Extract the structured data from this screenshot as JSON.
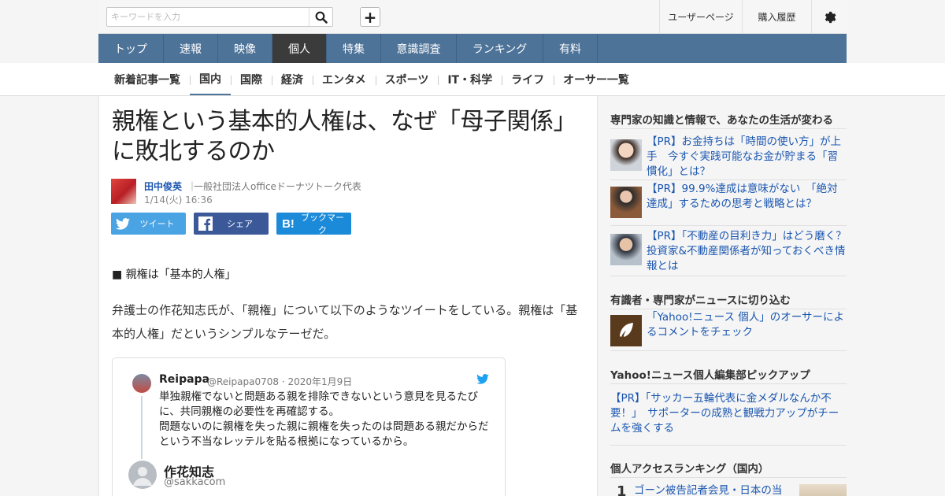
{
  "search": {
    "placeholder": "キーワードを入力"
  },
  "topbar": {
    "user_page": "ユーザーページ",
    "history": "購入履歴"
  },
  "nav": {
    "items": [
      "トップ",
      "速報",
      "映像",
      "個人",
      "特集",
      "意識調査",
      "ランキング",
      "有料"
    ],
    "active": "個人"
  },
  "subnav": {
    "items": [
      "新着記事一覧",
      "国内",
      "国際",
      "経済",
      "エンタメ",
      "スポーツ",
      "IT・科学",
      "ライフ",
      "オーサー一覧"
    ],
    "active": "国内"
  },
  "article": {
    "title_line1": "親権という基本的人権は、なぜ「母子関係」",
    "title_line2": "に敗北するのか",
    "author_name": "田中俊英",
    "author_separator": "｜",
    "author_role": "一般社団法人officeドーナツトーク代表",
    "date": "1/14(火) 16:36",
    "share": {
      "tweet": "ツイート",
      "facebook": "シェア",
      "hatena": "ブックマーク"
    },
    "section_heading": "■ 親権は「基本的人権」",
    "paragraph": "弁護士の作花知志氏が、「親権」について以下のようなツイートをしている。親権は「基本的人権」だというシンプルなテーゼだ。"
  },
  "tweet": {
    "name": "Reipapa",
    "handle": "@Reipapa0708",
    "date": "2020年1月9日",
    "handle_date": "@Reipapa0708 · 2020年1月9日",
    "line1": "単独親権でないと問題ある親を排除できないという意見を見るたびに、共同親権の必要性を再確認する。",
    "line2": "問題ないのに親権を失った親に親権を失ったのは問題ある親だからだという不当なレッテルを貼る根拠になっているから。",
    "reply_name": "作花知志",
    "reply_handle": "@sakkacom"
  },
  "sidebar": {
    "heading1": "専門家の知識と情報で、あなたの生活が変わる",
    "ads": [
      {
        "text": "【PR】お金持ちは「時間の使い方」が上手　今すぐ実践可能なお金が貯まる「習慣化」とは？"
      },
      {
        "text": "【PR】99.9%達成は意味がない　「絶対達成」するための思考と戦略とは？"
      },
      {
        "text": "【PR】「不動産の目利き力」はどう磨く？　投資家&不動産関係者が知っておくべき情報とは"
      }
    ],
    "heading2": "有識者・専門家がニュースに切り込む",
    "expert_link": "「Yahoo!ニュース 個人」のオーサーによるコメントをチェック",
    "heading3": "Yahoo!ニュース個人編集部ピックアップ",
    "pickup": "【PR】「サッカー五輪代表に金メダルなんか不要！」　サポーターの成熟と観戦力アップがチームを強くする",
    "heading4": "個人アクセスランキング（国内）",
    "ranking": [
      {
        "rank": "1",
        "text": "ゴーン被告記者会見・日本の当"
      }
    ]
  },
  "colors": {
    "nav_bg": "#4e7399",
    "nav_active": "#3b3b3b",
    "link": "#1a56b0",
    "twitter": "#4aa3e3",
    "facebook": "#3b5998",
    "hatena": "#1a8ad9"
  }
}
